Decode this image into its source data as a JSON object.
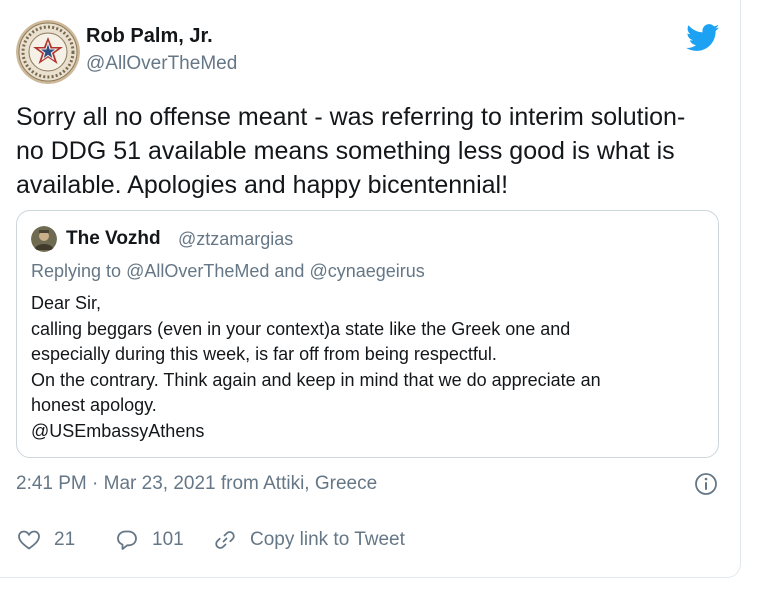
{
  "tweet": {
    "author": {
      "name": "Rob Palm, Jr.",
      "handle": "@AllOverTheMed",
      "avatar": "american-revolution-bicentennial-seal"
    },
    "text": "Sorry all no offense meant - was referring to interim solution-\nno DDG 51 available means something less good is what is\navailable. Apologies and happy bicentennial!",
    "timestamp": "2:41 PM · Mar 23, 2021 from Attiki, Greece",
    "actions": {
      "likes": "21",
      "replies": "101",
      "copy_link": "Copy link to Tweet"
    },
    "logo": "twitter-bird-icon"
  },
  "quoted_tweet": {
    "author": {
      "name": "The Vozhd",
      "handle": "@ztzamargias",
      "avatar": "profile-photo"
    },
    "replying_prefix": "Replying to ",
    "replying_to_1": "@AllOverTheMed",
    "replying_and": " and ",
    "replying_to_2": "@cynaegeirus",
    "body_lines": [
      "Dear Sir,",
      "calling beggars (even in your context)a state like the Greek one and",
      "especially during this week, is far off from being respectful.",
      "On the contrary. Think again and keep in mind that we do appreciate an",
      "honest apology.",
      "@USEmbassyAthens"
    ]
  },
  "colors": {
    "text_primary": "#14171a",
    "text_secondary": "#657786",
    "twitter_blue": "#1da1f2",
    "border": "#ccd6dd"
  }
}
